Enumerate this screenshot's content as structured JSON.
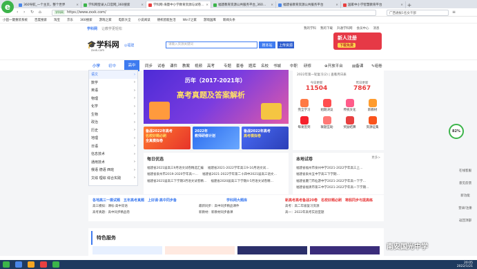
{
  "browser": {
    "tabs": [
      {
        "label": "360导航_一个主页，整个世界",
        "active": false
      },
      {
        "label": "学科网登录入口官网_360搜索",
        "active": false
      },
      {
        "label": "学科网-海量中小学教育资源与试卷…",
        "active": true
      },
      {
        "label": "福建教育资源公共服务平台_360…",
        "active": false
      },
      {
        "label": "福建省教育资源公共服务平台",
        "active": false
      },
      {
        "label": "国家中小学智慧教育平台",
        "active": false
      }
    ],
    "url": "https://www.zxxk.com/",
    "site_seal": "学科网",
    "search_hint": "广西通报1名女干部",
    "bookmarks": [
      "小田一键重装系统",
      "百度搜索",
      "淘宝",
      "京东",
      "360搜索",
      "游戏之家",
      "电影大全",
      "小说阅读",
      "德机智能生活",
      "Win7之家",
      "游戏国库",
      "新闻头条"
    ]
  },
  "site": {
    "top_links": [
      "学科网",
      "让教学更轻松"
    ],
    "user_links": [
      "我的学科",
      "我的下载",
      "升通学科网",
      "会员中心",
      "消息"
    ],
    "logo_text": "学科网",
    "logo_url": "zxxk.com",
    "location": "福建",
    "search_placeholder": "请输入资源关键词",
    "search_button": "搜本站",
    "upload_button": "上传资源",
    "ad_text": "新人注册",
    "ad_sub": "下载免费",
    "stages": [
      "小学",
      "初中",
      "高中"
    ],
    "main_nav": [
      "同步",
      "试卷",
      "课件",
      "教案",
      "视频",
      "高考",
      "专题",
      "套卷",
      "题库",
      "名校",
      "书城",
      "中职",
      "研修",
      "开放平台",
      "备课",
      "组卷"
    ],
    "subjects": [
      "语文",
      "数学",
      "英语",
      "物理",
      "化学",
      "生物",
      "政治",
      "历史",
      "地理",
      "日语",
      "信息技术",
      "通用技术",
      "俄语 德语 西班",
      "文综 理综 综合实践"
    ],
    "banner": {
      "title": "历年（2017-2021年）",
      "headline": "高考真题及答案解析"
    },
    "small_banners": [
      {
        "title": "备战2022年高考",
        "sub": "名校好题必刷",
        "tag": "全真模拟卷"
      },
      {
        "title": "2022年",
        "sub": "教师研修计划",
        "tag": ""
      },
      {
        "title": "备战2022年高考",
        "sub": "高考模拟卷",
        "tag": ""
      }
    ],
    "stats": {
      "note": "2022年第一轮复习(2) | 查看月日表",
      "today_label": "今日更新",
      "today_value": "11504",
      "yesterday_label": "昨日更新",
      "yesterday_value": "7867"
    },
    "quick_icons": [
      "完全学习",
      "组期决议",
      "传统文化",
      "新教材",
      "每发签到",
      "联题互助",
      "奖励结算",
      "资源征集"
    ],
    "daily_title": "每日优选",
    "daily_rows": [
      [
        "福建省2021届高三9月语文试卷精选汇编",
        "福建省2021-2022学年高三9-10月语文试…"
      ],
      [
        "福建省泉州市2019-2020学年高一…",
        "福建省2021-2022学年第二十四中2021届高三语文…"
      ],
      [
        "福建省2021届高三下学期3月语文试卷精…",
        "福建省2020届高三下学期4-5月语文试卷精…"
      ]
    ],
    "exam_title": "本地试卷",
    "exam_more": "更多>",
    "exam_rows": [
      "福建省福州市泉州中学2021-2022学年高三上…",
      "福建省泉州五中学高三下学期…",
      "福建省厦门市仙游中学2021-2022学年高一下学…",
      "福建省福清市第三中学2021-2022学年高一下学期…"
    ],
    "promo_cols": [
      {
        "title": "各地高三一模试题　五年高考真题　上好课·高中同步备",
        "rows": [
          "高三模拟：课标·高中双语",
          "高考真题：高中同步精品卷"
        ]
      },
      {
        "title": "学科网大题库",
        "rows": [
          "最新同步：高中同步精品课件",
          "新教材：新教材同步备课"
        ]
      },
      {
        "title": "新高考高考备战20卷　名校好题必刷　寒假同步与提高练",
        "rows": [
          "高考：高二年级复习资源",
          "高一：2022年高考实验室题"
        ]
      }
    ],
    "feature_title": "特色服务",
    "right_sidebar": [
      "82%",
      "在线客服",
      "意见反馈",
      "新功能",
      "登录/注册",
      "返回顶部"
    ]
  },
  "taskbar": {
    "clock_time": "20:05",
    "clock_date": "2022/1/21",
    "watermark": "南安国光中学"
  }
}
